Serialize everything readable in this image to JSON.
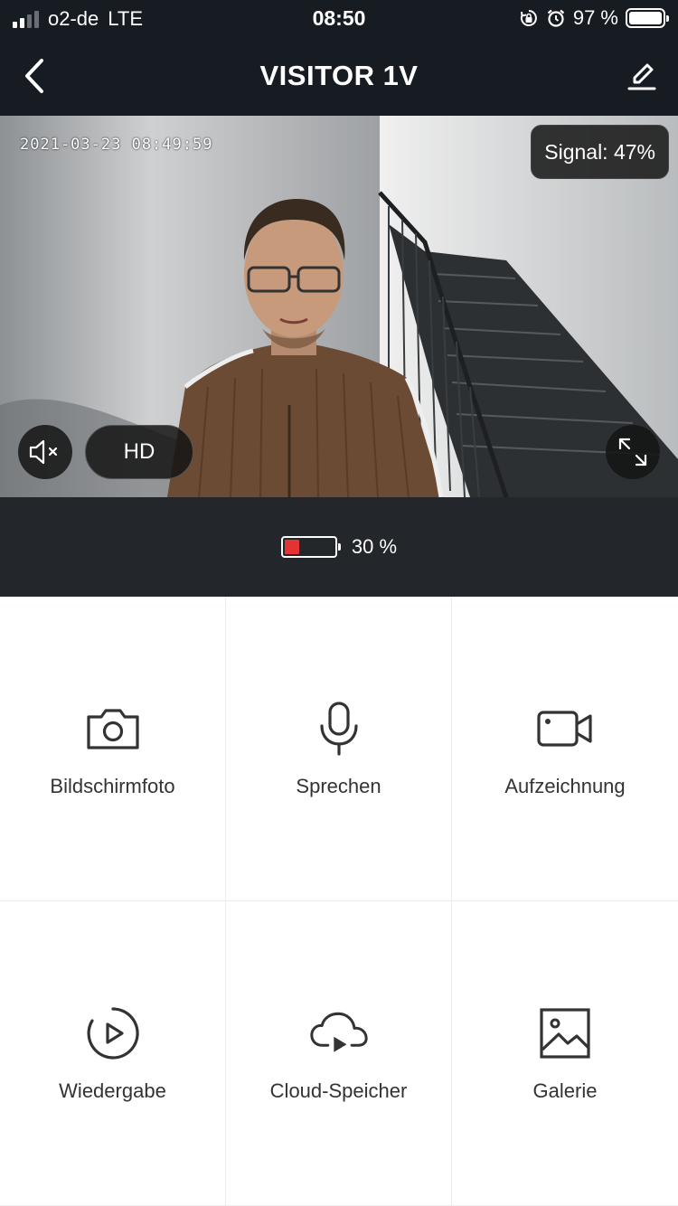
{
  "status_bar": {
    "carrier": "o2-de",
    "network": "LTE",
    "time": "08:50",
    "battery_percent": "97 %",
    "icons": [
      "signal-bars-icon",
      "rotation-lock-icon",
      "alarm-icon",
      "battery-icon"
    ]
  },
  "nav": {
    "title": "VISITOR 1V",
    "back_icon": "chevron-left-icon",
    "edit_icon": "pencil-icon"
  },
  "video": {
    "timestamp": "2021-03-23 08:49:59",
    "signal_label": "Signal: 47%",
    "quality_label": "HD",
    "mute_icon": "speaker-muted-icon",
    "fullscreen_icon": "expand-icon"
  },
  "device_battery": {
    "label": "30 %",
    "level": 0.3,
    "color": "#e33333"
  },
  "actions": [
    {
      "label": "Bildschirmfoto",
      "icon": "camera-icon"
    },
    {
      "label": "Sprechen",
      "icon": "microphone-icon"
    },
    {
      "label": "Aufzeichnung",
      "icon": "video-camera-icon"
    },
    {
      "label": "Wiedergabe",
      "icon": "playback-icon"
    },
    {
      "label": "Cloud-Speicher",
      "icon": "cloud-play-icon"
    },
    {
      "label": "Galerie",
      "icon": "gallery-icon"
    }
  ]
}
